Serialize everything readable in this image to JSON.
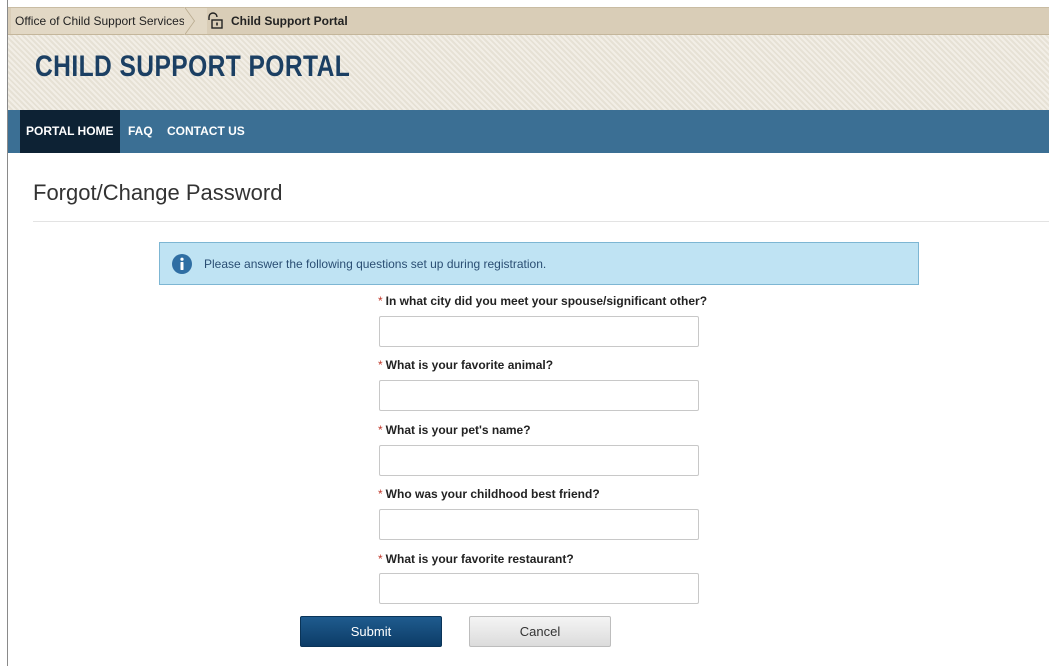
{
  "breadcrumb": {
    "parent": "Office of Child Support Services",
    "current": "Child Support Portal"
  },
  "header": {
    "title": "CHILD SUPPORT PORTAL"
  },
  "nav": {
    "items": [
      {
        "label": "PORTAL HOME",
        "active": true
      },
      {
        "label": "FAQ",
        "active": false
      },
      {
        "label": "CONTACT US",
        "active": false
      }
    ]
  },
  "page": {
    "title": "Forgot/Change Password"
  },
  "alert": {
    "text": "Please answer the following questions set up during registration."
  },
  "form": {
    "required_marker": "*",
    "questions": [
      {
        "label": "In what city did you meet your spouse/significant other?",
        "value": ""
      },
      {
        "label": "What is your favorite animal?",
        "value": ""
      },
      {
        "label": "What is your pet's name?",
        "value": ""
      },
      {
        "label": "Who was your childhood best friend?",
        "value": ""
      },
      {
        "label": "What is your favorite restaurant?",
        "value": ""
      }
    ],
    "submit_label": "Submit",
    "cancel_label": "Cancel"
  },
  "colors": {
    "nav_bg": "#3b6f94",
    "nav_active_bg": "#0d2234",
    "title_color": "#1b3f63",
    "alert_bg": "#bfe3f3",
    "submit_bg": "#0c3c67",
    "required": "#c0392b"
  },
  "icons": {
    "breadcrumb": "lock-icon",
    "alert": "info-icon"
  }
}
